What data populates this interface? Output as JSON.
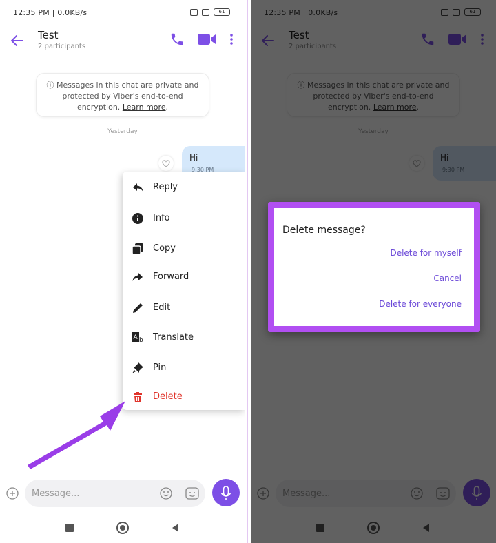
{
  "status_bar": {
    "text": "12:35 PM | 0.0KB/s",
    "battery": "61"
  },
  "header": {
    "title": "Test",
    "subtitle": "2 participants"
  },
  "privacy_notice": {
    "line1": "Messages in this chat are private and",
    "line2": "protected by Viber's end-to-end",
    "line3": "encryption. ",
    "learn_more": "Learn more",
    "suffix": "."
  },
  "date_separator": "Yesterday",
  "message": {
    "text": "Hi",
    "time": "9:30 PM"
  },
  "context_menu": {
    "items": [
      {
        "label": "Reply"
      },
      {
        "label": "Info"
      },
      {
        "label": "Copy"
      },
      {
        "label": "Forward"
      },
      {
        "label": "Edit"
      },
      {
        "label": "Translate"
      },
      {
        "label": "Pin"
      },
      {
        "label": "Delete"
      }
    ]
  },
  "composer": {
    "placeholder": "Message..."
  },
  "dialog": {
    "title": "Delete message?",
    "actions": [
      {
        "label": "Delete for myself"
      },
      {
        "label": "Cancel"
      },
      {
        "label": "Delete for everyone"
      }
    ]
  },
  "colors": {
    "accent": "#7d4fe6",
    "highlight_frame": "#b14ff2",
    "danger": "#e0342b",
    "bubble": "#d5e8fb"
  },
  "icons": [
    "back-arrow-icon",
    "phone-icon",
    "video-camera-icon",
    "more-vertical-icon",
    "info-icon",
    "heart-icon",
    "reply-icon",
    "copy-icon",
    "forward-icon",
    "edit-pencil-icon",
    "translate-icon",
    "pin-icon",
    "trash-icon",
    "plus-circle-icon",
    "emoji-icon",
    "sticker-icon",
    "microphone-icon"
  ]
}
